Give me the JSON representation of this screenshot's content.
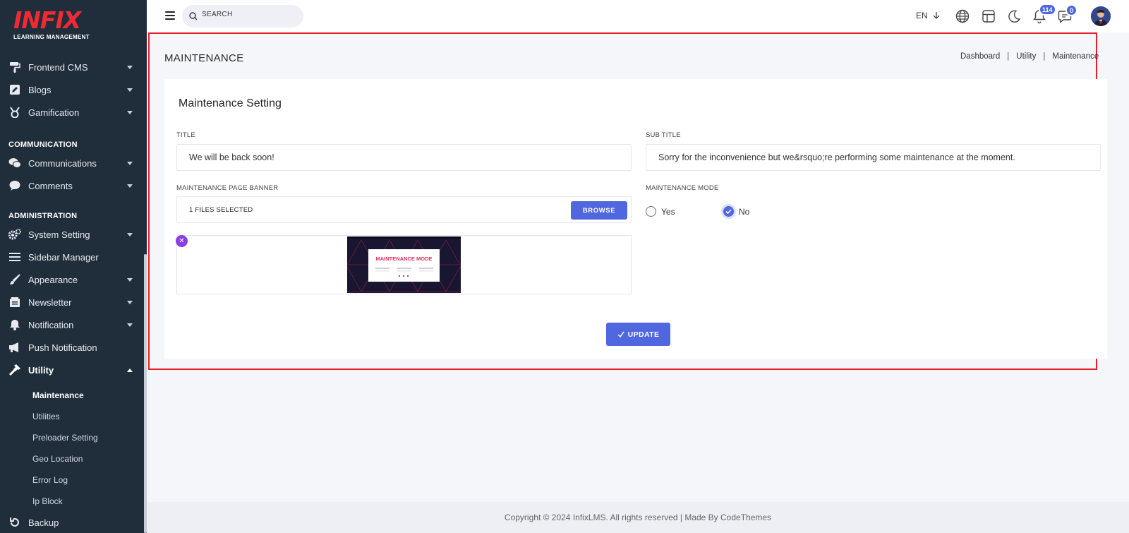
{
  "brand": {
    "logo_text": "INFIX",
    "logo_sub": "LEARNING MANAGEMENT",
    "accent": "#5067df",
    "sidebar_bg": "#202e3b",
    "highlight": "#e5202a"
  },
  "sidebar": {
    "items_top": [
      {
        "label": "Frontend CMS",
        "icon": "paint-roller-icon"
      },
      {
        "label": "Blogs",
        "icon": "edit-icon"
      },
      {
        "label": "Gamification",
        "icon": "medal-icon"
      }
    ],
    "communication_title": "COMMUNICATION",
    "items_comm": [
      {
        "label": "Communications",
        "icon": "chat-icon"
      },
      {
        "label": "Comments",
        "icon": "comment-icon"
      }
    ],
    "administration_title": "ADMINISTRATION",
    "items_admin": [
      {
        "label": "System Setting",
        "icon": "gears-icon"
      },
      {
        "label": "Sidebar Manager",
        "icon": "list-icon"
      },
      {
        "label": "Appearance",
        "icon": "brush-icon"
      },
      {
        "label": "Newsletter",
        "icon": "newspaper-icon"
      },
      {
        "label": "Notification",
        "icon": "bell-icon"
      },
      {
        "label": "Push Notification",
        "icon": "megaphone-icon"
      },
      {
        "label": "Utility",
        "icon": "hammer-icon"
      }
    ],
    "utility_sub": [
      "Maintenance",
      "Utilities",
      "Preloader Setting",
      "Geo Location",
      "Error Log",
      "Ip Block"
    ],
    "backup_label": "Backup"
  },
  "topbar": {
    "search_placeholder": "SEARCH",
    "lang": "EN",
    "notifications_count": "114",
    "messages_count": "0"
  },
  "page": {
    "title": "MAINTENANCE",
    "breadcrumb": [
      "Dashboard",
      "Utility",
      "Maintenance"
    ],
    "card_title": "Maintenance Setting",
    "title_label": "TITLE",
    "title_value": "We will be back soon!",
    "subtitle_label": "SUB TITLE",
    "subtitle_value": "Sorry for the inconvenience but we&rsquo;re performing some maintenance at the moment.",
    "banner_label": "MAINTENANCE PAGE BANNER",
    "files_selected": "1 FILES SELECTED",
    "browse_label": "BROWSE",
    "banner_preview_title": "MAINTENANCE MODE",
    "mode_label": "MAINTENANCE MODE",
    "mode_options": [
      "Yes",
      "No"
    ],
    "mode_selected": "No",
    "update_label": "UPDATE"
  },
  "footer": {
    "text": "Copyright © 2024 InfixLMS. All rights reserved | Made By CodeThemes"
  }
}
